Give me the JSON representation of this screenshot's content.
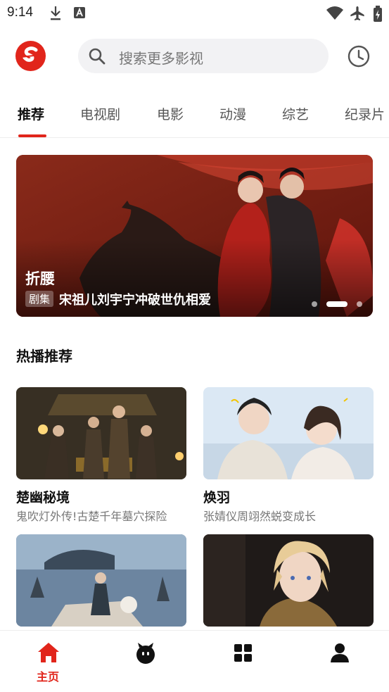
{
  "status_bar": {
    "time": "9:14"
  },
  "header": {
    "search_placeholder": "搜索更多影视"
  },
  "tabs": [
    {
      "label": "推荐"
    },
    {
      "label": "电视剧"
    },
    {
      "label": "电影"
    },
    {
      "label": "动漫"
    },
    {
      "label": "综艺"
    },
    {
      "label": "纪录片"
    }
  ],
  "active_tab": "推荐",
  "banner": {
    "title": "折腰",
    "tag": "剧集",
    "subtitle": "宋祖儿刘宇宁冲破世仇相爱",
    "page_count": 3,
    "active_index": 1
  },
  "hot_section": {
    "title": "热播推荐",
    "items": [
      {
        "title": "楚幽秘境",
        "desc": "鬼吹灯外传!古楚千年墓穴探险"
      },
      {
        "title": "焕羽",
        "desc": "张婧仪周翊然蜕变成长"
      },
      {
        "title": "",
        "desc": ""
      },
      {
        "title": "",
        "desc": ""
      }
    ]
  },
  "bottom_nav": {
    "items": [
      {
        "icon": "home-icon",
        "label": "主页",
        "active": true
      },
      {
        "icon": "mascot-icon",
        "label": "",
        "active": false
      },
      {
        "icon": "grid-icon",
        "label": "",
        "active": false
      },
      {
        "icon": "person-icon",
        "label": "",
        "active": false
      }
    ]
  },
  "colors": {
    "accent": "#e1251b",
    "text_primary": "#111111",
    "text_secondary": "#777777"
  }
}
